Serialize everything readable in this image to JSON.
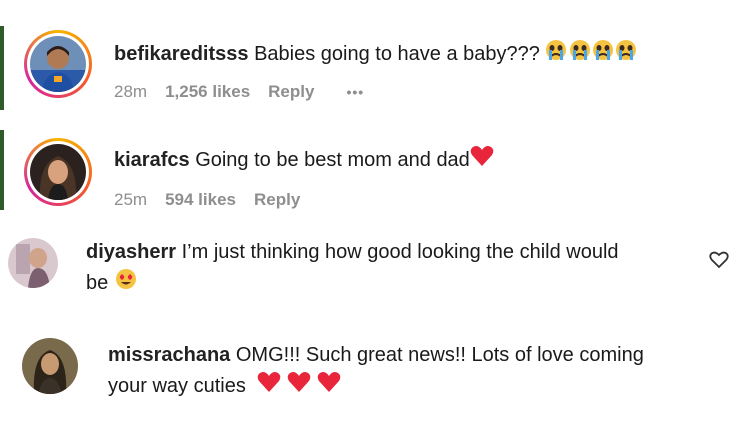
{
  "comments": [
    {
      "username": "befikareditsss",
      "text": "Babies going to have a baby???",
      "time": "28m",
      "likes": "1,256 likes",
      "reply": "Reply",
      "more": "•••"
    },
    {
      "username": "kiarafcs",
      "text": "Going to be best mom and dad",
      "time": "25m",
      "likes": "594 likes",
      "reply": "Reply"
    },
    {
      "username": "diyasherr",
      "text_line1": "I’m just thinking how good looking the child would",
      "text_line2": "be"
    },
    {
      "username": "missrachana",
      "text_line1": "OMG!!! Such great news!! Lots of love coming",
      "text_line2": "your way cuties"
    }
  ],
  "colors": {
    "heart": "#e8253b",
    "muted": "#8e8e8e",
    "text": "#1a1a1a"
  },
  "icons": [
    "crying-emoji-icon",
    "red-heart-icon",
    "heart-eyes-emoji-icon",
    "like-heart-outline-icon",
    "more-icon"
  ]
}
